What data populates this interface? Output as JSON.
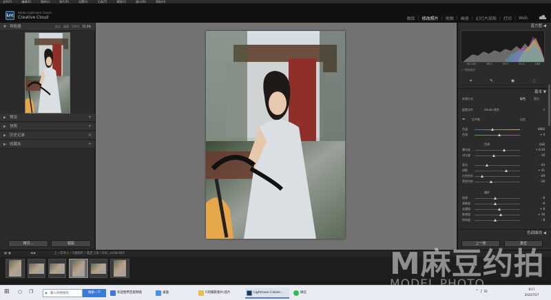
{
  "menubar": {
    "items": [
      "文件(F)",
      "编辑(E)",
      "图库(L)",
      "照片(P)",
      "设置(S)",
      "工具(T)",
      "视图(V)",
      "窗口(W)",
      "帮助(H)"
    ]
  },
  "identity": {
    "logo": "Lrc",
    "brand_line1": "Adobe Lightroom Classic",
    "brand_line2": "Creative Cloud"
  },
  "modules": [
    "图库",
    "修改照片",
    "地图",
    "画册",
    "幻灯片放映",
    "打印",
    "Web"
  ],
  "active_module": "修改照片",
  "left_panel": {
    "navigator_title": "导航器",
    "zoom_options": [
      "适合",
      "填满",
      "100%"
    ],
    "zoom_value": "72.5%",
    "sections": [
      "预设",
      "快照",
      "历史记录",
      "收藏夹"
    ],
    "copy_button": "拷贝...",
    "paste_button": "粘贴"
  },
  "right_panel": {
    "histogram_title": "直方图",
    "exif": [
      "ISO 100",
      "60.0",
      "f/5.0",
      "50.0",
      "1/60"
    ],
    "original_label": "原始照片",
    "basic_title": "基本",
    "treatment_label": "处理方式",
    "treatment_color": "彩色",
    "treatment_bw": "黑白",
    "profile_label": "配置文件",
    "profile_value": "Adobe 颜色",
    "wb_label": "白平衡",
    "wb_value": "自定",
    "temp_label": "色温",
    "temp_value": "4800",
    "tint_label": "色调",
    "tint_value": "+ 4",
    "tone_label": "色调",
    "auto_label": "自动",
    "tone_sliders": [
      {
        "label": "曝光度",
        "value": "+ 0.34",
        "position": 0.65
      },
      {
        "label": "对比度",
        "value": "- 16",
        "position": 0.42
      }
    ],
    "light_sliders": [
      {
        "label": "高光",
        "value": "- 44",
        "position": 0.28
      },
      {
        "label": "阴影",
        "value": "+ 41",
        "position": 0.7
      },
      {
        "label": "白色色阶",
        "value": "- 69",
        "position": 0.16
      },
      {
        "label": "黑色色阶",
        "value": "- 26",
        "position": 0.37
      }
    ],
    "presence_label": "偏好",
    "presence_sliders": [
      {
        "label": "纹理",
        "value": "- 8",
        "position": 0.46
      },
      {
        "label": "清晰度",
        "value": "- 8",
        "position": 0.46
      },
      {
        "label": "去朦胧",
        "value": "+ 8",
        "position": 0.54
      },
      {
        "label": "鲜艳度",
        "value": "+ 16",
        "position": 0.58
      },
      {
        "label": "饱和度",
        "value": "- 8",
        "position": 0.46
      }
    ],
    "tone_curve_title": "色调曲线",
    "prev_button": "上一张",
    "reset_button": "复位"
  },
  "filmbar": {
    "path": "上一次导入 / 5张照片 / 选定 1张 / DSC_4438.NEF"
  },
  "watermark": {
    "big": "M麻豆约拍",
    "small": "MODEL PHOTO"
  },
  "taskbar": {
    "search_placeholder": "输入你想搜的",
    "search_button": "搜索一下",
    "apps": [
      "欢迎使用百度网盘",
      "桌面",
      "Fi的摄影图片/选片",
      "Lightroom Catalo...",
      "微信"
    ],
    "time": "8:17",
    "date": "2022/7/27"
  },
  "colors": {
    "accent": "#3a7bd5",
    "panel": "#2b2b2b",
    "canvas": "#737373"
  }
}
